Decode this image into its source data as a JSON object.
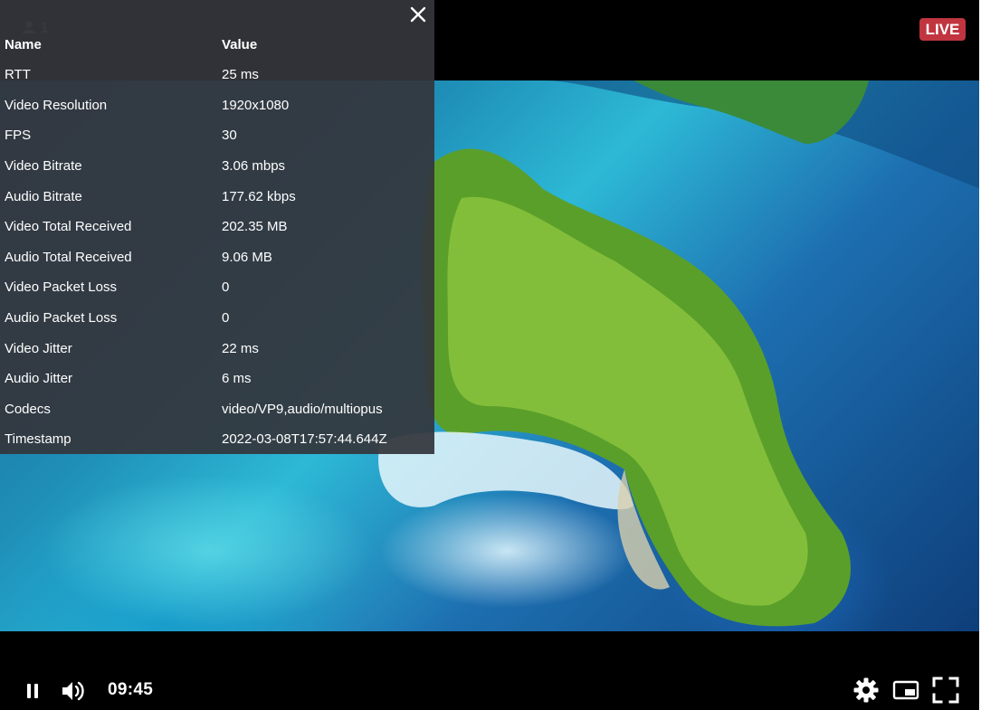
{
  "header": {
    "viewer_count": "1",
    "live_label": "LIVE"
  },
  "stats": {
    "headers": {
      "name": "Name",
      "value": "Value"
    },
    "rows": [
      {
        "name": "RTT",
        "value": "25 ms"
      },
      {
        "name": "Video Resolution",
        "value": "1920x1080"
      },
      {
        "name": "FPS",
        "value": "30"
      },
      {
        "name": "Video Bitrate",
        "value": "3.06 mbps"
      },
      {
        "name": "Audio Bitrate",
        "value": "177.62 kbps"
      },
      {
        "name": "Video Total Received",
        "value": "202.35 MB"
      },
      {
        "name": "Audio Total Received",
        "value": "9.06 MB"
      },
      {
        "name": "Video Packet Loss",
        "value": "0"
      },
      {
        "name": "Audio Packet Loss",
        "value": "0"
      },
      {
        "name": "Video Jitter",
        "value": "22 ms"
      },
      {
        "name": "Audio Jitter",
        "value": "6 ms"
      },
      {
        "name": "Codecs",
        "value": "video/VP9,audio/multiopus"
      },
      {
        "name": "Timestamp",
        "value": "2022-03-08T17:57:44.644Z"
      }
    ]
  },
  "controls": {
    "time": "09:45",
    "icons": [
      "pause-icon",
      "volume-icon",
      "settings-icon",
      "picture-in-picture-icon",
      "fullscreen-icon",
      "close-icon",
      "user-icon"
    ]
  },
  "colors": {
    "live_badge": "#c0353f",
    "stats_panel": "#34363c"
  }
}
